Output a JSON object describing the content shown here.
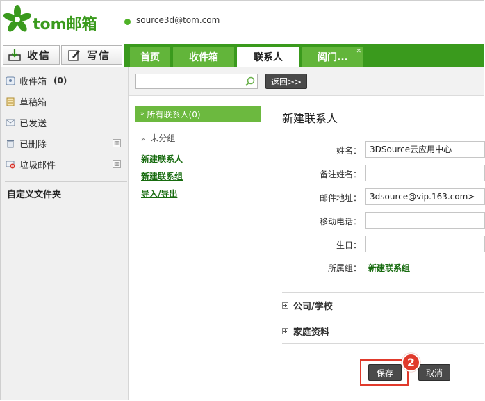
{
  "header": {
    "logo_text": "tom邮箱",
    "user_email": "source3d@tom.com"
  },
  "toolbar_top": {
    "receive_label": "收信",
    "compose_label": "写信"
  },
  "tabs": [
    {
      "label": "首页",
      "active": false
    },
    {
      "label": "收件箱",
      "active": false
    },
    {
      "label": "联系人",
      "active": true
    },
    {
      "label": "阅门...",
      "active": false
    }
  ],
  "sidebar": {
    "items": [
      {
        "label": "收件箱",
        "count": "(0)"
      },
      {
        "label": "草稿箱",
        "count": ""
      },
      {
        "label": "已发送",
        "count": ""
      },
      {
        "label": "已删除",
        "count": ""
      },
      {
        "label": "垃圾邮件",
        "count": ""
      }
    ],
    "custom_folder_label": "自定义文件夹"
  },
  "search": {
    "value": "",
    "back_label": "返回>>"
  },
  "groups": {
    "all_contacts": "所有联系人(0)",
    "ungrouped": "未分组",
    "links": [
      "新建联系人",
      "新建联系组",
      "导入/导出"
    ]
  },
  "form": {
    "title": "新建联系人",
    "fields": [
      {
        "label": "姓名：",
        "value": "3DSource云应用中心"
      },
      {
        "label": "备注姓名：",
        "value": ""
      },
      {
        "label": "邮件地址：",
        "value": "3dsource@vip.163.com>"
      },
      {
        "label": "移动电话：",
        "value": ""
      },
      {
        "label": "生日：",
        "value": ""
      }
    ],
    "group_label": "所属组：",
    "group_link": "新建联系组",
    "sections": [
      "公司/学校",
      "家庭资料"
    ],
    "save_label": "保存",
    "cancel_label": "取消",
    "step_number": "2"
  },
  "colors": {
    "brand_green": "#3a9a1d",
    "tab_green": "#62b53a",
    "highlight_red": "#e03a2c"
  }
}
